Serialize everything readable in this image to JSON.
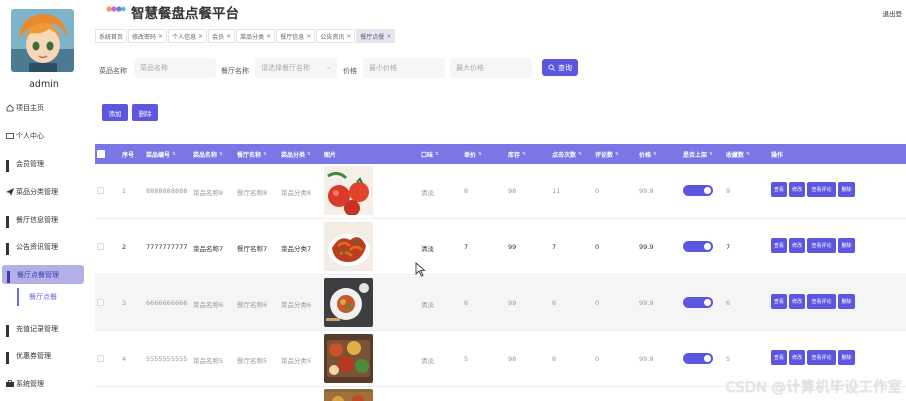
{
  "app": {
    "title": "智慧餐盘点餐平台",
    "logout": "退出登",
    "username": "admin"
  },
  "sidebar": {
    "items": [
      {
        "label": "项目主页"
      },
      {
        "label": "个人中心"
      },
      {
        "label": "会员管理"
      },
      {
        "label": "菜品分类管理"
      },
      {
        "label": "餐厅信息管理"
      },
      {
        "label": "公告资讯管理"
      },
      {
        "label": "餐厅点餐管理"
      },
      {
        "label": "充值记录管理"
      },
      {
        "label": "优惠券管理"
      },
      {
        "label": "系统管理"
      }
    ],
    "sub_item": "餐厅点餐"
  },
  "tabs": [
    {
      "label": "系统首页",
      "closable": false
    },
    {
      "label": "修改密码",
      "closable": true
    },
    {
      "label": "个人信息",
      "closable": true
    },
    {
      "label": "会员",
      "closable": true
    },
    {
      "label": "菜品分类",
      "closable": true
    },
    {
      "label": "餐厅信息",
      "closable": true
    },
    {
      "label": "公告资讯",
      "closable": true
    },
    {
      "label": "餐厅点餐",
      "closable": true,
      "active": true
    }
  ],
  "search": {
    "dish_name_label": "菜品名称",
    "dish_name_placeholder": "菜品名称",
    "restaurant_label": "餐厅名称",
    "restaurant_placeholder": "请选择餐厅名称",
    "price_label": "价格",
    "min_price_placeholder": "最小价格",
    "max_price_placeholder": "最大价格",
    "query_label": "查询"
  },
  "actions": {
    "add": "添加",
    "delete": "删除"
  },
  "table": {
    "headers": [
      "序号",
      "菜品编号",
      "菜品名称",
      "餐厅名称",
      "菜品分类",
      "图片",
      "口味",
      "单价",
      "库存",
      "点击次数",
      "评论数",
      "价格",
      "是否上架",
      "收藏数",
      "操作"
    ],
    "op_buttons": [
      "查看",
      "修改",
      "查看评论",
      "删除"
    ],
    "rows": [
      {
        "no": "1",
        "code": "8888888888",
        "name": "菜品名称8",
        "restaurant": "餐厅名称8",
        "category": "菜品分类8",
        "taste": "清淡",
        "unit_price": "8",
        "stock": "98",
        "clicks": "11",
        "comments": "0",
        "price": "99.9",
        "favorites": "9"
      },
      {
        "no": "2",
        "code": "7777777777",
        "name": "菜品名称7",
        "restaurant": "餐厅名称7",
        "category": "菜品分类7",
        "taste": "清淡",
        "unit_price": "7",
        "stock": "99",
        "clicks": "7",
        "comments": "0",
        "price": "99.9",
        "favorites": "7"
      },
      {
        "no": "3",
        "code": "6666666666",
        "name": "菜品名称6",
        "restaurant": "餐厅名称6",
        "category": "菜品分类6",
        "taste": "清淡",
        "unit_price": "6",
        "stock": "99",
        "clicks": "6",
        "comments": "0",
        "price": "99.9",
        "favorites": "6"
      },
      {
        "no": "4",
        "code": "5555555555",
        "name": "菜品名称5",
        "restaurant": "餐厅名称5",
        "category": "菜品分类5",
        "taste": "清淡",
        "unit_price": "5",
        "stock": "98",
        "clicks": "8",
        "comments": "0",
        "price": "99.9",
        "favorites": "5"
      }
    ]
  },
  "watermark": "CSDN @计算机毕设工作室",
  "colors": {
    "accent": "#5c56e0",
    "header_bg": "#7b76e6",
    "active_menu": "#b3b0e8"
  }
}
